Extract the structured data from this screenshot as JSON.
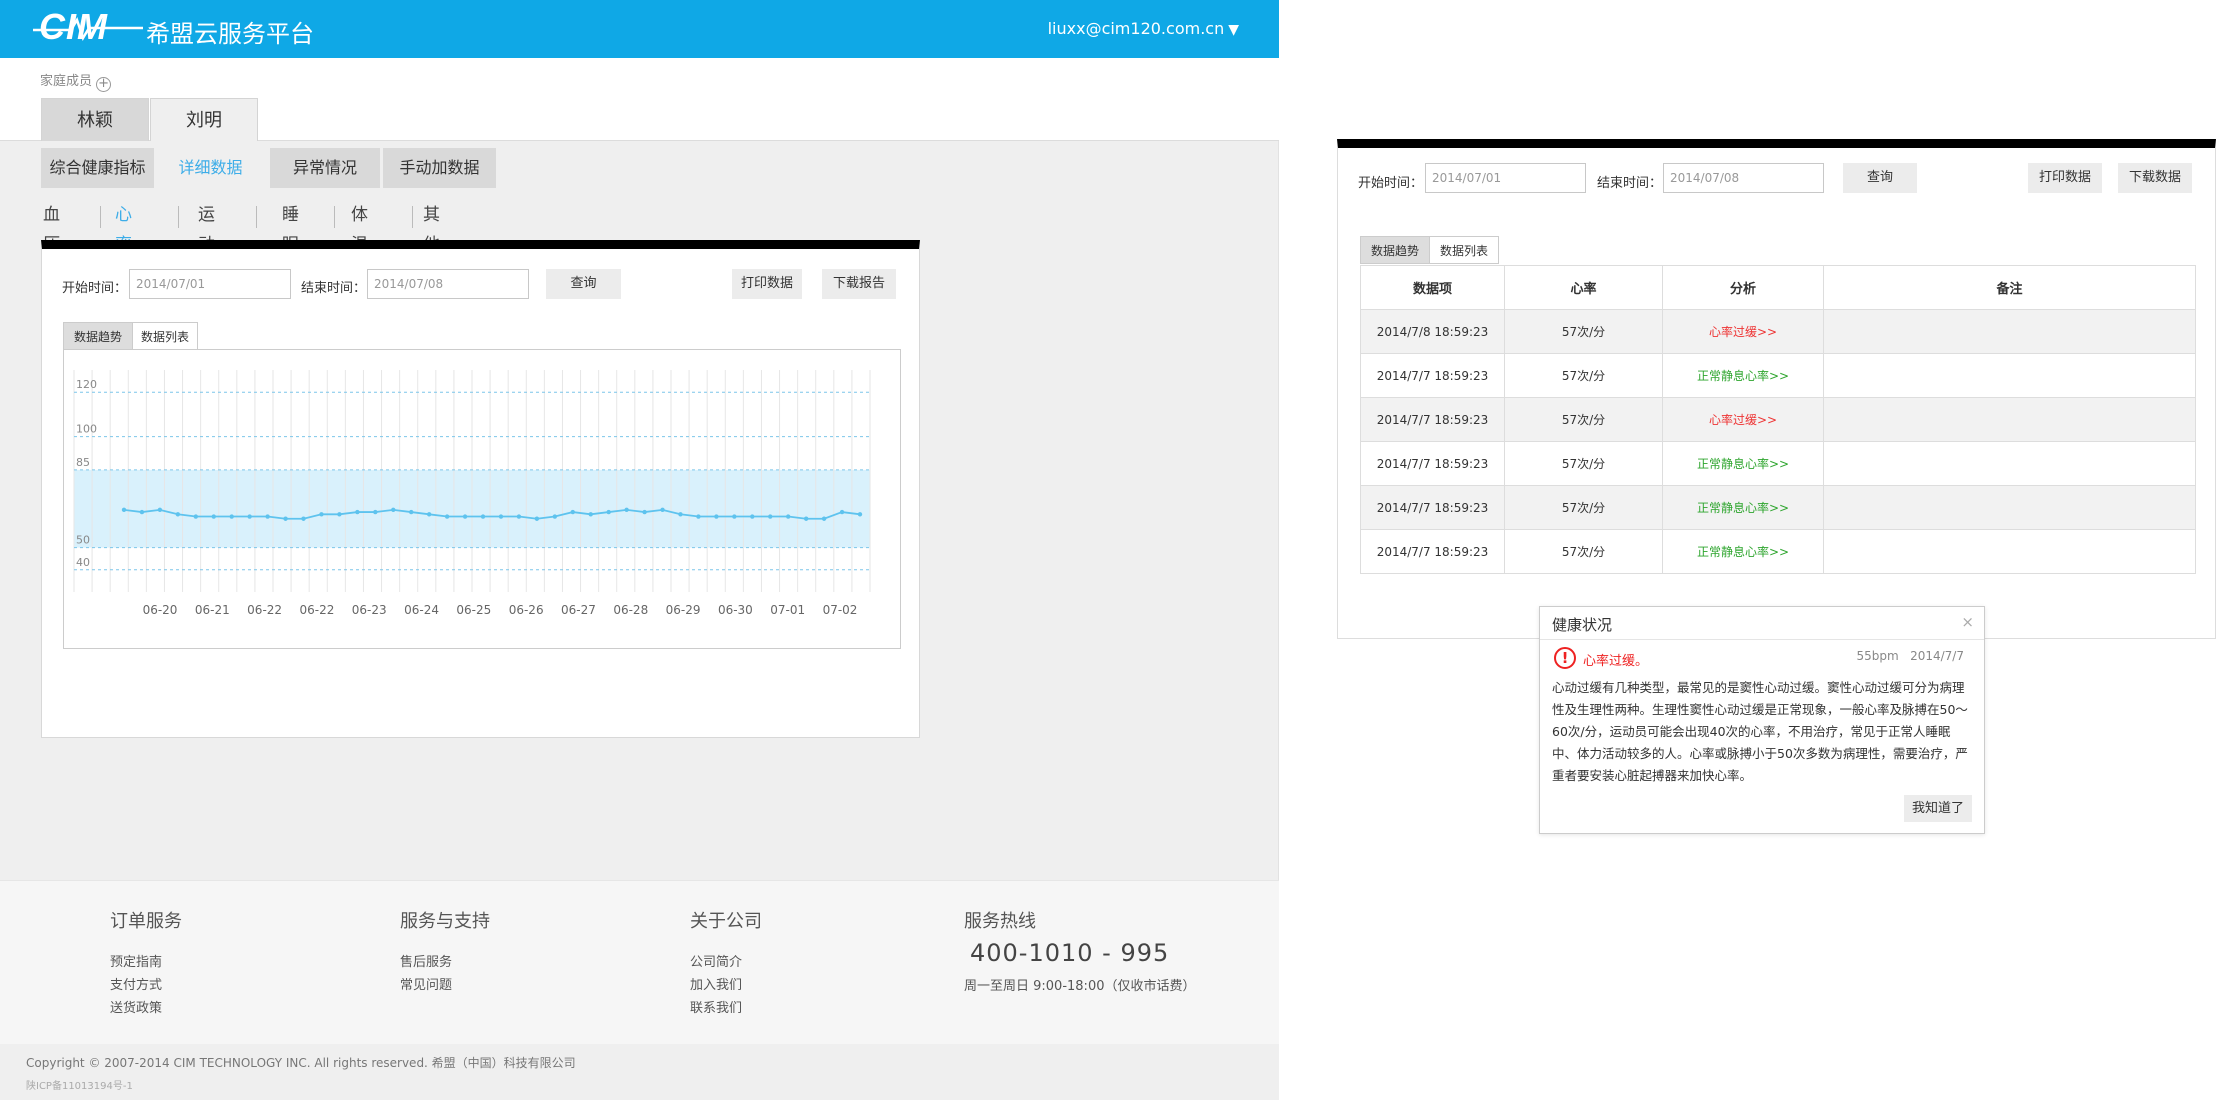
{
  "header": {
    "logo_text": "CIM",
    "platform_name": "希盟云服务平台",
    "user_email": "liuxx@cim120.com.cn",
    "caret": "▼",
    "brand_color": "#0fa8e6"
  },
  "family": {
    "label": "家庭成员",
    "members": [
      "林颖",
      "刘明"
    ]
  },
  "subtabs": [
    "综合健康指标",
    "详细数据",
    "异常情况",
    "手动加数据"
  ],
  "metrics": [
    "血压",
    "心率",
    "运动",
    "睡眠",
    "体温",
    "其他"
  ],
  "query": {
    "start_label": "开始时间：",
    "start_value": "2014/07/01",
    "end_label": "结束时间：",
    "end_value": "2014/07/08",
    "query_btn": "查询",
    "print_btn": "打印数据",
    "download_report_btn": "下载报告",
    "download_data_btn": "下载数据"
  },
  "view_tabs": [
    "数据趋势",
    "数据列表"
  ],
  "chart_data": {
    "type": "line",
    "categories": [
      "06-20",
      "06-21",
      "06-22",
      "06-22",
      "06-23",
      "06-24",
      "06-25",
      "06-26",
      "06-27",
      "06-28",
      "06-29",
      "06-30",
      "07-01",
      "07-02"
    ],
    "y_ticks": [
      40,
      50,
      85,
      100,
      120
    ],
    "ylim": [
      30,
      130
    ],
    "normal_band": [
      50,
      85
    ],
    "grid": true,
    "series": [
      {
        "values": [
          67,
          66,
          67,
          65,
          64,
          64,
          64,
          64,
          64,
          63,
          63,
          65,
          65,
          66,
          66,
          67,
          66,
          65,
          64,
          64,
          64,
          64,
          64,
          63,
          64,
          66,
          65,
          66,
          67,
          66,
          67,
          65,
          64,
          64,
          64,
          64,
          64,
          64,
          63,
          63,
          66,
          65
        ]
      }
    ]
  },
  "table": {
    "headers": [
      "数据项",
      "心率",
      "分析",
      "备注"
    ],
    "rows": [
      {
        "time": "2014/7/8 18:59:23",
        "rate": "57次/分",
        "analysis": "心率过缓>>",
        "status": "red",
        "note": ""
      },
      {
        "time": "2014/7/7 18:59:23",
        "rate": "57次/分",
        "analysis": "正常静息心率>>",
        "status": "green",
        "note": ""
      },
      {
        "time": "2014/7/7 18:59:23",
        "rate": "57次/分",
        "analysis": "心率过缓>>",
        "status": "red",
        "note": ""
      },
      {
        "time": "2014/7/7 18:59:23",
        "rate": "57次/分",
        "analysis": "正常静息心率>>",
        "status": "green",
        "note": ""
      },
      {
        "time": "2014/7/7 18:59:23",
        "rate": "57次/分",
        "analysis": "正常静息心率>>",
        "status": "green",
        "note": ""
      },
      {
        "time": "2014/7/7 18:59:23",
        "rate": "57次/分",
        "analysis": "正常静息心率>>",
        "status": "green",
        "note": ""
      }
    ]
  },
  "popup": {
    "title": "健康状况",
    "close": "×",
    "alert": "心率过缓。",
    "bpm": "55bpm",
    "date": "2014/7/7",
    "body": "心动过缓有几种类型，最常见的是窦性心动过缓。窦性心动过缓可分为病理性及生理性两种。生理性窦性心动过缓是正常现象，一般心率及脉搏在50～60次/分，运动员可能会出现40次的心率，不用治疗，常见于正常人睡眠中、体力活动较多的人。心率或脉搏小于50次多数为病理性，需要治疗，严重者要安装心脏起搏器来加快心率。",
    "ok": "我知道了"
  },
  "footer": {
    "cols": [
      {
        "head": "订单服务",
        "links": [
          "预定指南",
          "支付方式",
          "送货政策"
        ]
      },
      {
        "head": "服务与支持",
        "links": [
          "售后服务",
          "常见问题"
        ]
      },
      {
        "head": "关于公司",
        "links": [
          "公司简介",
          "加入我们",
          "联系我们"
        ]
      }
    ],
    "hotline_head": "服务热线",
    "hotline": "400-1010 - 995",
    "hours": "周一至周日 9:00-18:00（仅收市话费）",
    "copyright": "Copyright © 2007-2014 CIM TECHNOLOGY INC. All rights reserved. 希盟（中国）科技有限公司",
    "icp": "陕ICP备11013194号-1"
  }
}
